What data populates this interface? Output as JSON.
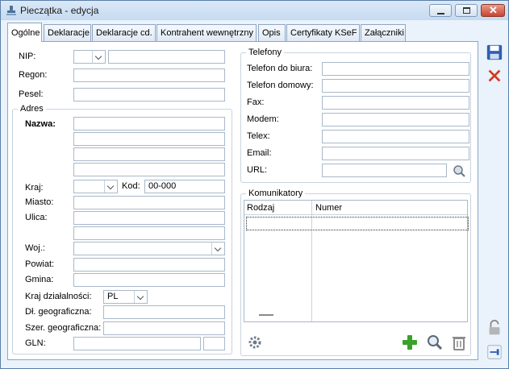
{
  "window": {
    "title": "Pieczątka - edycja"
  },
  "tabs": [
    {
      "label": "Ogólne",
      "active": true
    },
    {
      "label": "Deklaracje",
      "active": false
    },
    {
      "label": "Deklaracje cd.",
      "active": false
    },
    {
      "label": "Kontrahent wewnętrzny",
      "active": false
    },
    {
      "label": "Opis",
      "active": false
    },
    {
      "label": "Certyfikaty KSeF",
      "active": false
    },
    {
      "label": "Załączniki",
      "active": false
    }
  ],
  "left": {
    "nip_label": "NIP:",
    "nip_prefix_value": "",
    "nip_value": "",
    "regon_label": "Regon:",
    "regon_value": "",
    "pesel_label": "Pesel:",
    "pesel_value": "",
    "adres": {
      "title": "Adres",
      "nazwa_label": "Nazwa:",
      "nazwa_lines": [
        "",
        "",
        "",
        ""
      ],
      "kraj_label": "Kraj:",
      "kraj_value": "",
      "kod_label": "Kod:",
      "kod_value": "00-000",
      "miasto_label": "Miasto:",
      "miasto_value": "",
      "ulica_label": "Ulica:",
      "ulica_lines": [
        "",
        ""
      ],
      "woj_label": "Woj.:",
      "woj_value": "",
      "powiat_label": "Powiat:",
      "powiat_value": "",
      "gmina_label": "Gmina:",
      "gmina_value": "",
      "kraj_dzialalnosci_label": "Kraj działalności:",
      "kraj_dzialalnosci_value": "PL",
      "dl_geo_label": "Dł. geograficzna:",
      "dl_geo_value": "",
      "szer_geo_label": "Szer. geograficzna:",
      "szer_geo_value": "",
      "gln_label": "GLN:",
      "gln_value": "",
      "gln_check_value": ""
    }
  },
  "telefony": {
    "title": "Telefony",
    "fields": [
      {
        "label": "Telefon do biura:",
        "value": ""
      },
      {
        "label": "Telefon domowy:",
        "value": ""
      },
      {
        "label": "Fax:",
        "value": ""
      },
      {
        "label": "Modem:",
        "value": ""
      },
      {
        "label": "Telex:",
        "value": ""
      },
      {
        "label": "Email:",
        "value": ""
      },
      {
        "label": "URL:",
        "value": ""
      }
    ]
  },
  "komunikatory": {
    "title": "Komunikatory",
    "columns": [
      "Rodzaj",
      "Numer"
    ]
  },
  "colors": {
    "accent": "#5a7fa8",
    "add": "#3aa12a",
    "delete": "#d23b22",
    "save": "#2f5fb3"
  }
}
